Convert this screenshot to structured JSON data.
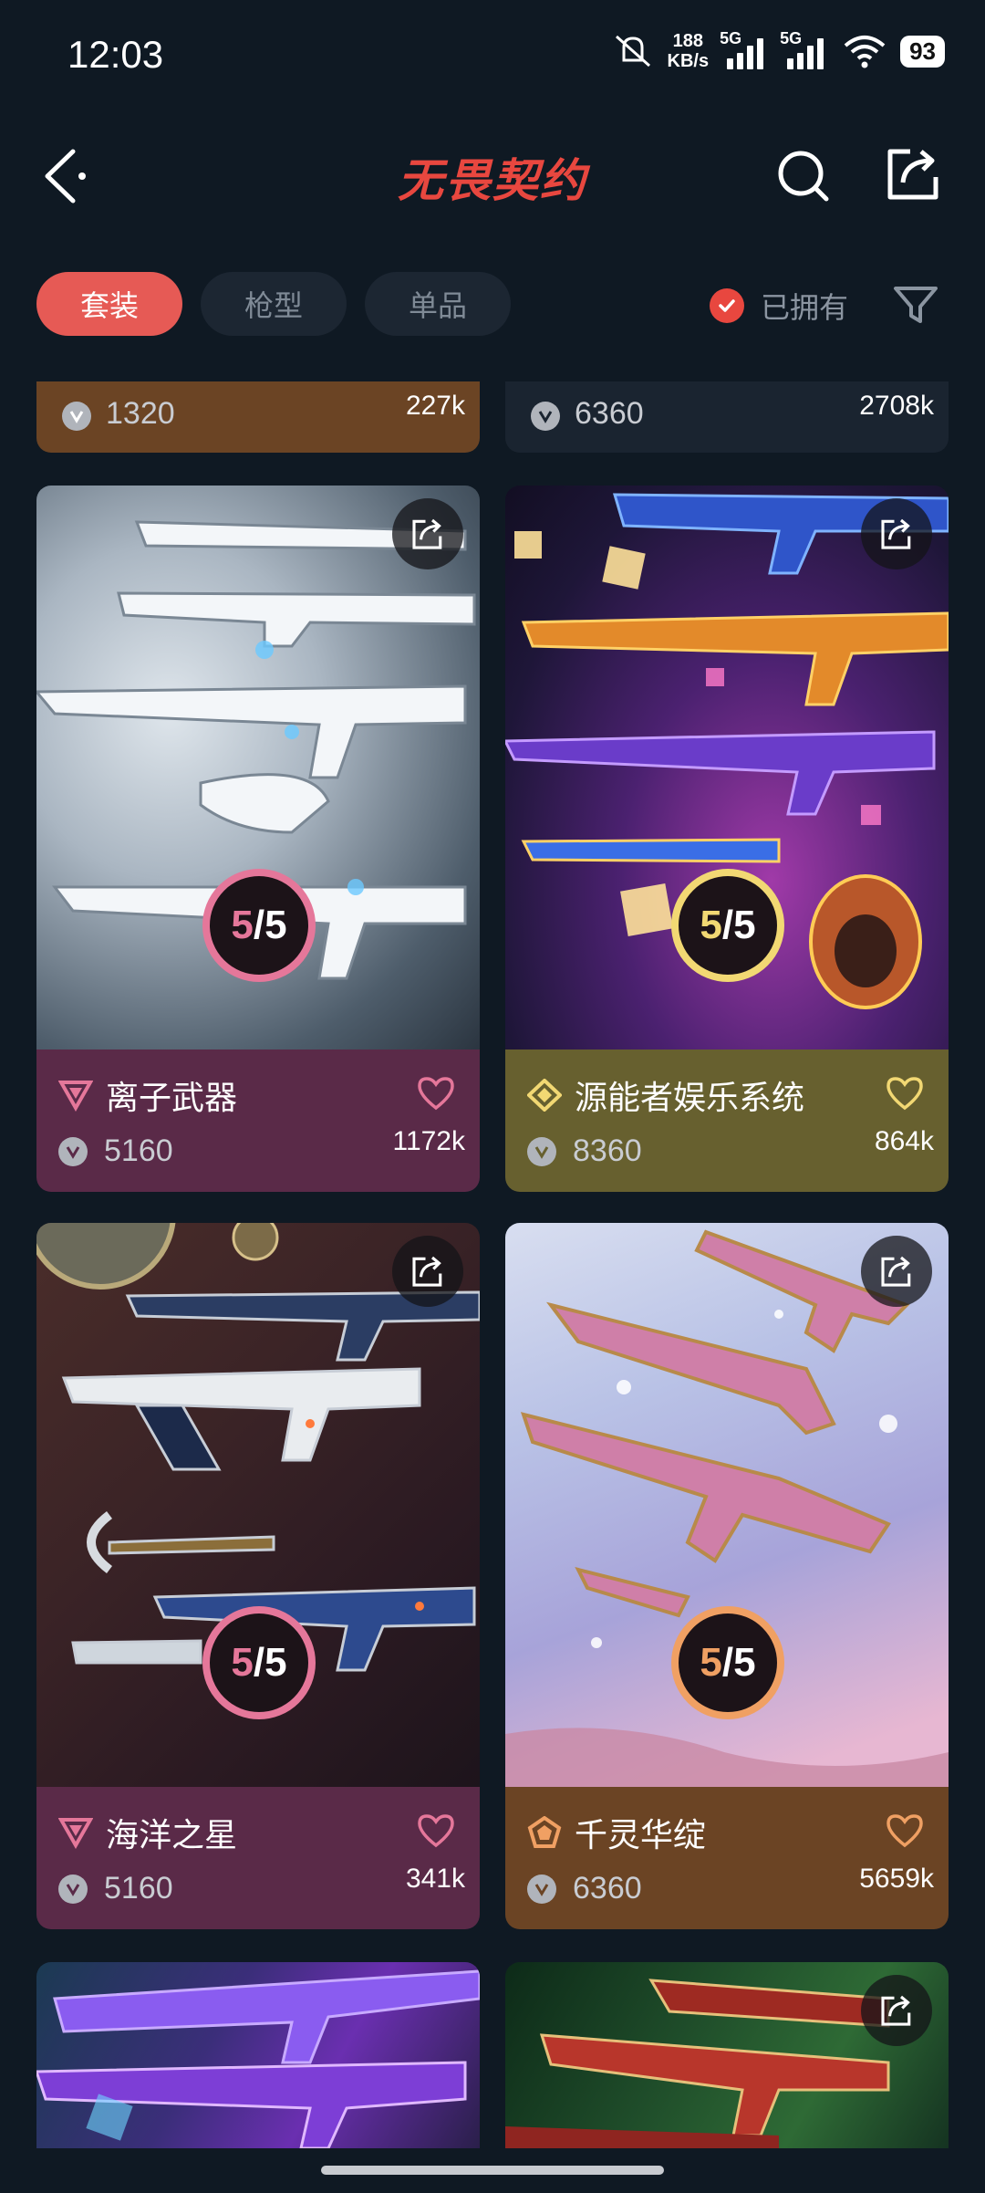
{
  "status": {
    "time": "12:03",
    "speed_value": "188",
    "speed_unit": "KB/s",
    "sig1": "5G",
    "sig2": "5G",
    "battery": "93"
  },
  "header": {
    "logo": "无畏契约"
  },
  "filters": {
    "tabs": [
      "套装",
      "枪型",
      "单品"
    ],
    "owned_label": "已拥有"
  },
  "top_cards": [
    {
      "price": "1320",
      "likes": "227k"
    },
    {
      "price": "6360",
      "likes": "2708k"
    }
  ],
  "cards": [
    {
      "name": "离子武器",
      "price": "5160",
      "likes": "1172k",
      "owned": "5/5",
      "tier": "premium",
      "accent": "#e5779a",
      "bg": "#5a2a48"
    },
    {
      "name": "源能者娱乐系统",
      "price": "8360",
      "likes": "864k",
      "owned": "5/5",
      "tier": "ultra",
      "accent": "#f2d873",
      "bg": "#67602f"
    },
    {
      "name": "海洋之星",
      "price": "5160",
      "likes": "341k",
      "owned": "5/5",
      "tier": "premium",
      "accent": "#e5779a",
      "bg": "#5a2a48"
    },
    {
      "name": "千灵华绽",
      "price": "6360",
      "likes": "5659k",
      "owned": "5/5",
      "tier": "exclusive",
      "accent": "#f0a063",
      "bg": "#6b4424"
    }
  ]
}
